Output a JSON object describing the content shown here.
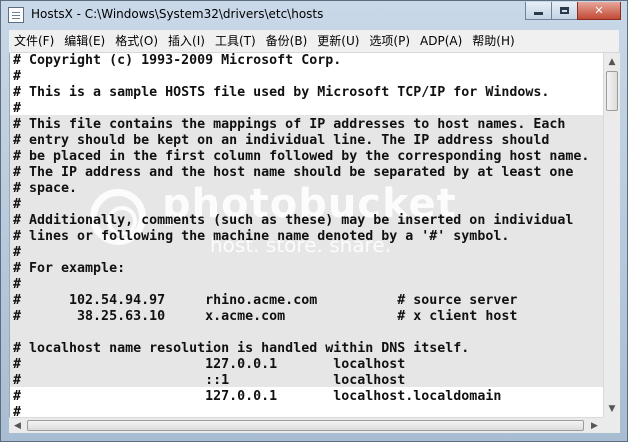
{
  "window": {
    "title": "HostsX - C:\\Windows\\System32\\drivers\\etc\\hosts",
    "icon": "notepad-icon",
    "buttons": {
      "minimize": "minimize-icon",
      "maximize": "maximize-icon",
      "close": "✕"
    }
  },
  "menu": [
    "文件(F)",
    "编辑(E)",
    "格式(O)",
    "插入(I)",
    "工具(T)",
    "备份(B)",
    "更新(U)",
    "选项(P)",
    "ADP(A)",
    "帮助(H)"
  ],
  "editor": {
    "lines": [
      "# Copyright (c) 1993-2009 Microsoft Corp.",
      "#",
      "# This is a sample HOSTS file used by Microsoft TCP/IP for Windows.",
      "#",
      "# This file contains the mappings of IP addresses to host names. Each",
      "# entry should be kept on an individual line. The IP address should",
      "# be placed in the first column followed by the corresponding host name.",
      "# The IP address and the host name should be separated by at least one",
      "# space.",
      "#",
      "# Additionally, comments (such as these) may be inserted on individual",
      "# lines or following the machine name denoted by a '#' symbol.",
      "#",
      "# For example:",
      "#",
      "#      102.54.94.97     rhino.acme.com          # source server",
      "#       38.25.63.10     x.acme.com              # x client host",
      "",
      "# localhost name resolution is handled within DNS itself.",
      "#                       127.0.0.1       localhost",
      "#                       ::1             localhost",
      "#                       127.0.0.1       localhost.localdomain",
      "#"
    ]
  },
  "watermark": {
    "brand": "photobucket",
    "tagline": "host. store. share."
  },
  "colors": {
    "window_frame": "#b9c9d9",
    "menu_bg": "#f0f0f0",
    "editor_bg": "#ffffff",
    "watermark_band": "#e6e6e6",
    "close_button": "#c24a35"
  }
}
